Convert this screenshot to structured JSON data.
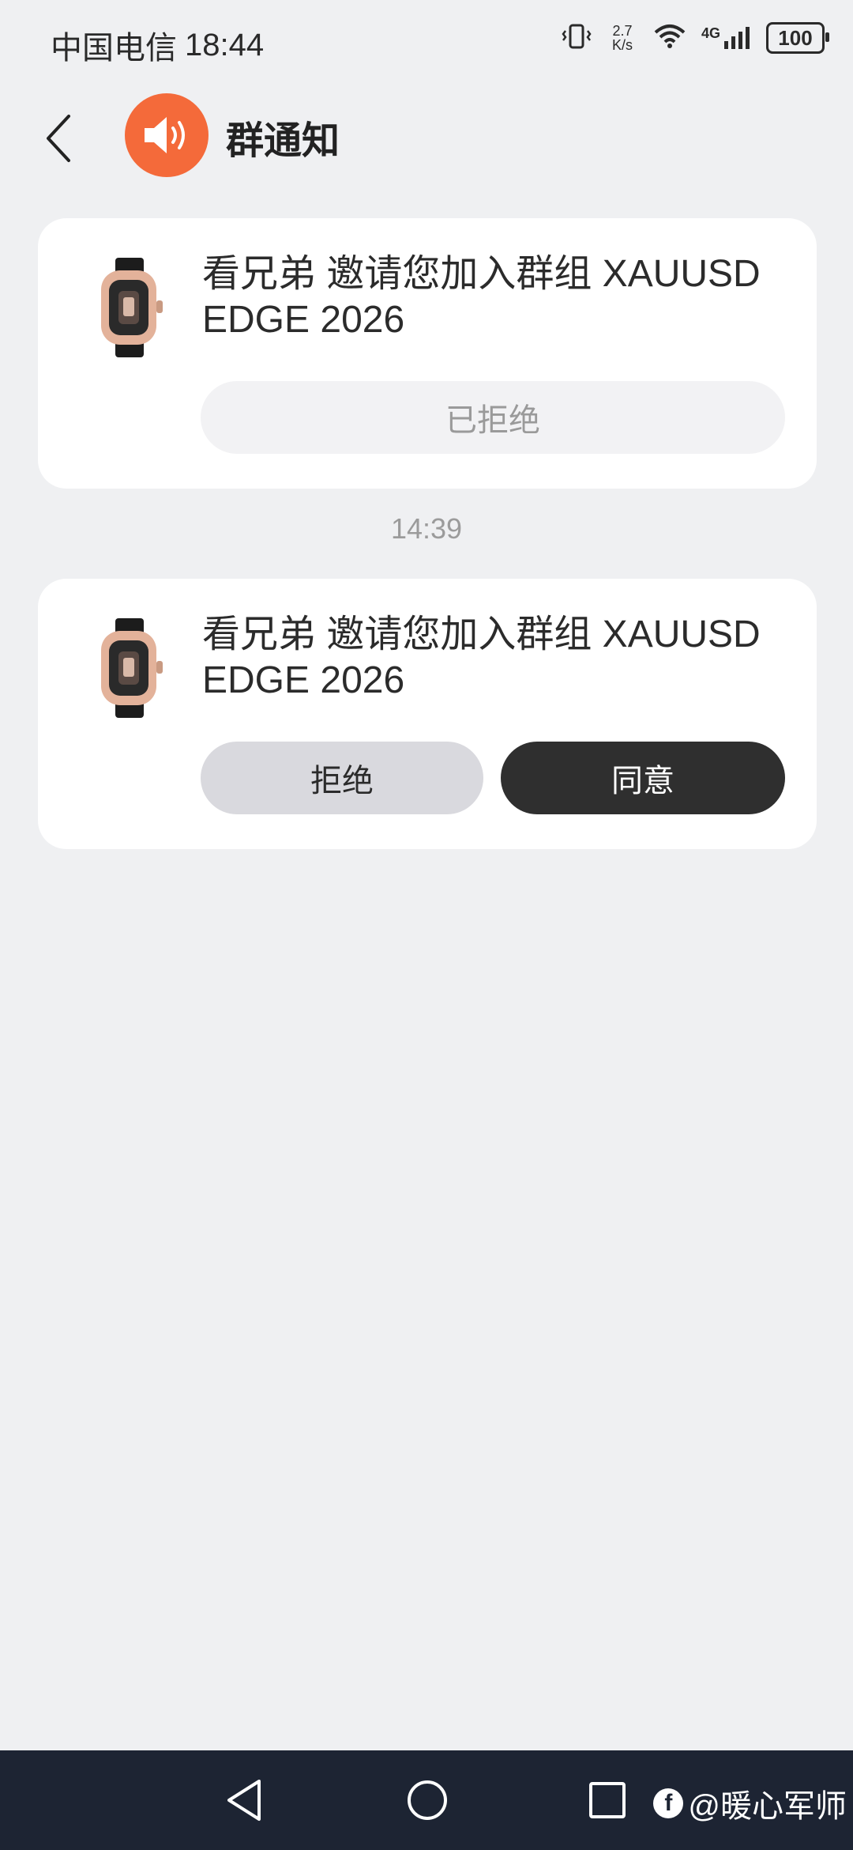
{
  "status_bar": {
    "carrier": "中国电信",
    "time": "18:44",
    "net_speed_value": "2.7",
    "net_speed_unit": "K/s",
    "network_type": "4G",
    "battery": "100"
  },
  "header": {
    "title": "群通知",
    "avatar_icon": "speaker-icon",
    "back_icon": "chevron-left-icon"
  },
  "notifications": [
    {
      "text": "看兄弟 邀请您加入群组 XAUUSD EDGE 2026",
      "status": "已拒绝"
    },
    {
      "text": "看兄弟 邀请您加入群组 XAUUSD EDGE 2026",
      "reject_label": "拒绝",
      "accept_label": "同意"
    }
  ],
  "timestamp": "14:39",
  "nav": {
    "back_icon": "triangle-back-icon",
    "home_icon": "circle-home-icon",
    "recent_icon": "square-recent-icon"
  },
  "watermark": {
    "badge": "f",
    "text": "@暖心军师"
  },
  "colors": {
    "background": "#eff0f2",
    "accent_orange": "#f46a3a",
    "accept_button": "#2f2f2f",
    "reject_button": "#d9d9de",
    "nav_bar": "#1d2433"
  }
}
